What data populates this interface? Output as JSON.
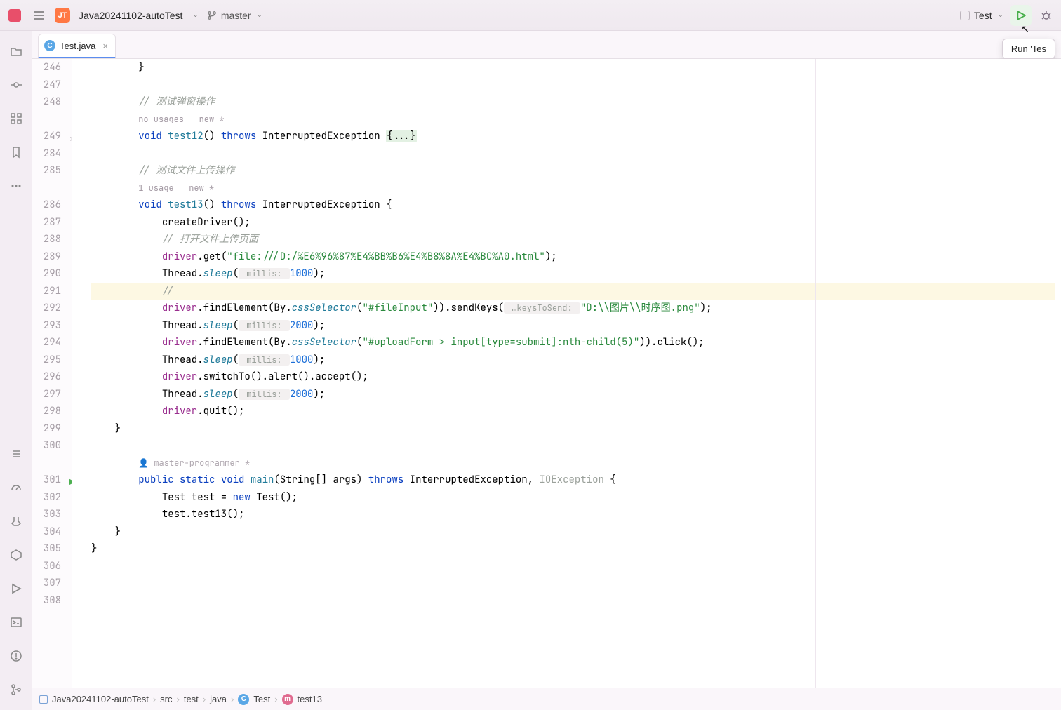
{
  "topbar": {
    "project_badge": "JT",
    "project_name": "Java20241102-autoTest",
    "branch": "master",
    "run_config": "Test",
    "tooltip": "Run 'Tes"
  },
  "tabs": [
    {
      "badge": "C",
      "label": "Test.java"
    }
  ],
  "gutter_lines": [
    "246",
    "247",
    "248",
    "",
    "249",
    "284",
    "285",
    "",
    "286",
    "287",
    "288",
    "289",
    "290",
    "291",
    "292",
    "293",
    "294",
    "295",
    "296",
    "297",
    "298",
    "299",
    "300",
    "",
    "301",
    "302",
    "303",
    "304",
    "305",
    "306",
    "307",
    "308"
  ],
  "code": {
    "l246": "        }",
    "l248_cmt": "// 测试弹窗操作",
    "l248_usages": "no usages   new *",
    "l249_kw": "void",
    "l249_name": "test12",
    "l249_throws": "throws",
    "l249_ex": "InterruptedException",
    "l249_fold": "{...}",
    "l285_cmt": "// 测试文件上传操作",
    "l285_usages": "1 usage   new *",
    "l286_kw": "void",
    "l286_name": "test13",
    "l286_throws": "throws",
    "l286_ex": "InterruptedException {",
    "l287": "createDriver();",
    "l288_cmt": "// 打开文件上传页面",
    "l289_d": "driver",
    "l289_m": ".get(",
    "l289_s": "\"file:///D:/%E6%96%87%E4%BB%B6%E4%B8%8A%E4%BC%A0.html\"",
    "l289_e": ");",
    "l290_a": "Thread.",
    "l290_sl": "sleep",
    "l290_p": "(",
    "l290_h": " millis: ",
    "l290_n": "1000",
    "l290_e": ");",
    "l291": "//",
    "l292_d": "driver",
    "l292_a": ".findElement(By.",
    "l292_css": "cssSelector",
    "l292_b": "(",
    "l292_s": "\"#fileInput\"",
    "l292_c": ")).sendKeys(",
    "l292_h": " …keysToSend: ",
    "l292_s2": "\"D:\\\\图片\\\\时序图.png\"",
    "l292_e": ");",
    "l293_a": "Thread.",
    "l293_sl": "sleep",
    "l293_p": "(",
    "l293_h": " millis: ",
    "l293_n": "2000",
    "l293_e": ");",
    "l294_d": "driver",
    "l294_a": ".findElement(By.",
    "l294_css": "cssSelector",
    "l294_b": "(",
    "l294_s": "\"#uploadForm > input[type=submit]:nth-child(5)\"",
    "l294_c": ")).click();",
    "l295_a": "Thread.",
    "l295_sl": "sleep",
    "l295_p": "(",
    "l295_h": " millis: ",
    "l295_n": "1000",
    "l295_e": ");",
    "l296_d": "driver",
    "l296_e": ".switchTo().alert().accept();",
    "l297_a": "Thread.",
    "l297_sl": "sleep",
    "l297_p": "(",
    "l297_h": " millis: ",
    "l297_n": "2000",
    "l297_e": ");",
    "l298_d": "driver",
    "l298_e": ".quit();",
    "l299": "    }",
    "l300_author": "master-programmer *",
    "l301_pub": "public",
    "l301_st": "static",
    "l301_vd": "void",
    "l301_main": "main",
    "l301_args": "(String[] args)",
    "l301_throws": "throws",
    "l301_ex": "InterruptedException, ",
    "l301_io": "IOException",
    "l301_br": " {",
    "l302_a": "Test test = ",
    "l302_new": "new",
    "l302_b": " Test();",
    "l303": "test.test13();",
    "l304": "    }",
    "l305": "}"
  },
  "breadcrumb": {
    "root": "Java20241102-autoTest",
    "p1": "src",
    "p2": "test",
    "p3": "java",
    "class": "Test",
    "method": "test13"
  }
}
